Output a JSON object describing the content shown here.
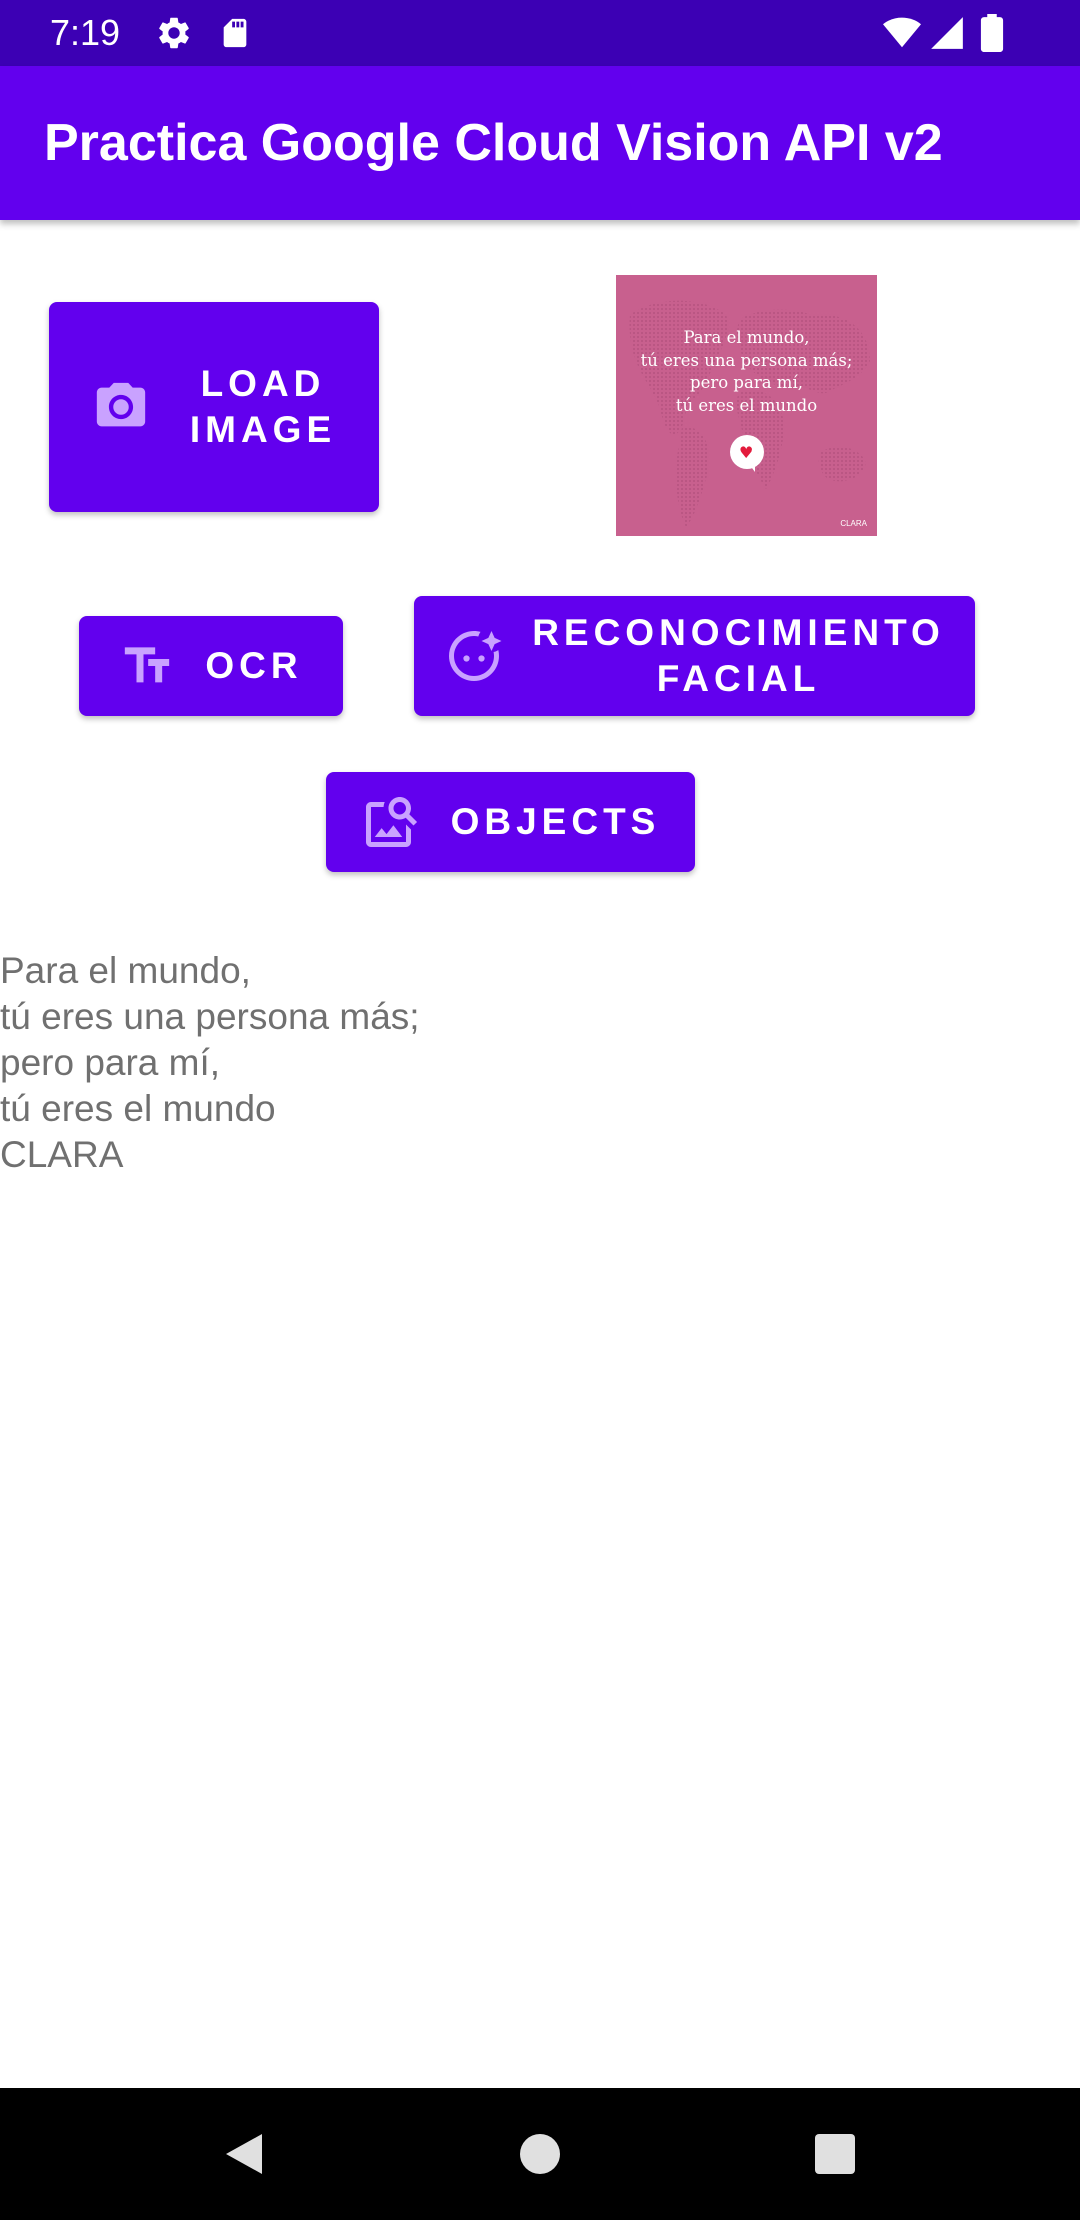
{
  "status_bar": {
    "time": "7:19",
    "icons": [
      "gear-icon",
      "sd-card-icon",
      "wifi-icon",
      "signal-icon",
      "battery-icon"
    ]
  },
  "app_bar": {
    "title": "Practica Google Cloud Vision API v2"
  },
  "buttons": {
    "load_image": {
      "line1": "LOAD",
      "line2": "IMAGE",
      "icon": "camera-icon"
    },
    "ocr": {
      "label": "OCR",
      "icon": "text-fields-icon"
    },
    "facial": {
      "line1": "RECONOCIMIENTO",
      "line2": "FACIAL",
      "icon": "face-retouching-icon"
    },
    "objects": {
      "label": "OBJECTS",
      "icon": "image-search-icon"
    }
  },
  "preview_image": {
    "lines": [
      "Para el mundo,",
      "tú eres una persona más;",
      "pero para mí,",
      "tú eres el mundo"
    ],
    "brand": "CLARA"
  },
  "result_text": {
    "lines": [
      "Para el mundo,",
      "tú eres una persona más;",
      "pero para mí,",
      "tú eres el mundo",
      "CLARA"
    ]
  },
  "navigation_bar": {
    "buttons": [
      "back-icon",
      "home-icon",
      "recents-icon"
    ]
  },
  "colors": {
    "primary": "#6200ee",
    "status_bar": "#3c00b4",
    "button_icon": "#c9a2ff",
    "result_text": "#707070",
    "preview_background": "#c8608e"
  }
}
